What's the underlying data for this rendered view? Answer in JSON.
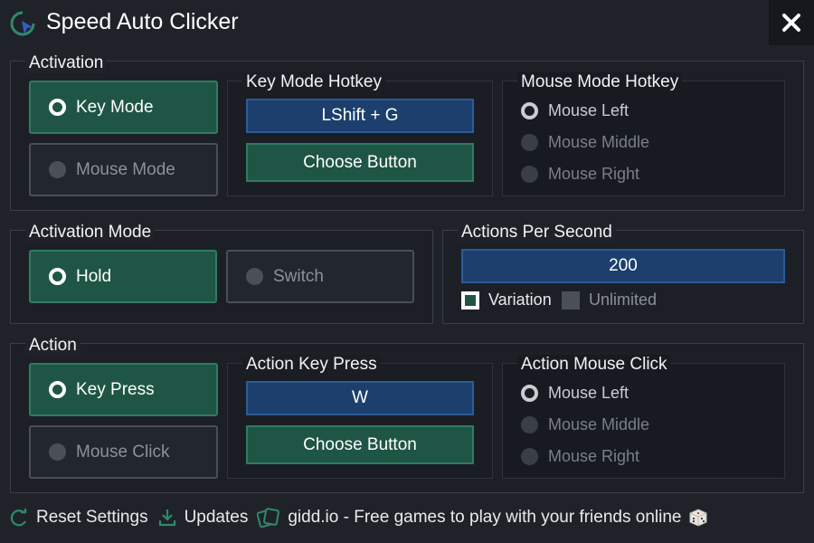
{
  "window": {
    "title": "Speed Auto Clicker",
    "close_symbol": "✕"
  },
  "colors": {
    "accent_green": "#1f5544",
    "accent_blue": "#1c3f6d",
    "background": "#1f2329"
  },
  "activation": {
    "legend": "Activation",
    "key_mode": "Key Mode",
    "mouse_mode": "Mouse Mode",
    "selected": "Key Mode"
  },
  "key_mode_hotkey": {
    "legend": "Key Mode Hotkey",
    "value": "LShift + G",
    "choose_button": "Choose Button"
  },
  "mouse_mode_hotkey": {
    "legend": "Mouse Mode Hotkey",
    "options": [
      "Mouse Left",
      "Mouse Middle",
      "Mouse Right"
    ],
    "selected": "Mouse Left"
  },
  "activation_mode": {
    "legend": "Activation Mode",
    "hold": "Hold",
    "switch": "Switch",
    "selected": "Hold"
  },
  "actions_per_second": {
    "legend": "Actions Per Second",
    "value": "200",
    "variation_label": "Variation",
    "variation_checked": true,
    "unlimited_label": "Unlimited",
    "unlimited_checked": false
  },
  "action": {
    "legend": "Action",
    "key_press": "Key Press",
    "mouse_click": "Mouse Click",
    "selected": "Key Press"
  },
  "action_key_press": {
    "legend": "Action Key Press",
    "value": "W",
    "choose_button": "Choose Button"
  },
  "action_mouse_click": {
    "legend": "Action Mouse Click",
    "options": [
      "Mouse Left",
      "Mouse Middle",
      "Mouse Right"
    ],
    "selected": "Mouse Left"
  },
  "footer": {
    "reset": "Reset Settings",
    "updates": "Updates",
    "gidd": "gidd.io - Free games to play with your friends online",
    "dice_icon": "dice-icon"
  }
}
